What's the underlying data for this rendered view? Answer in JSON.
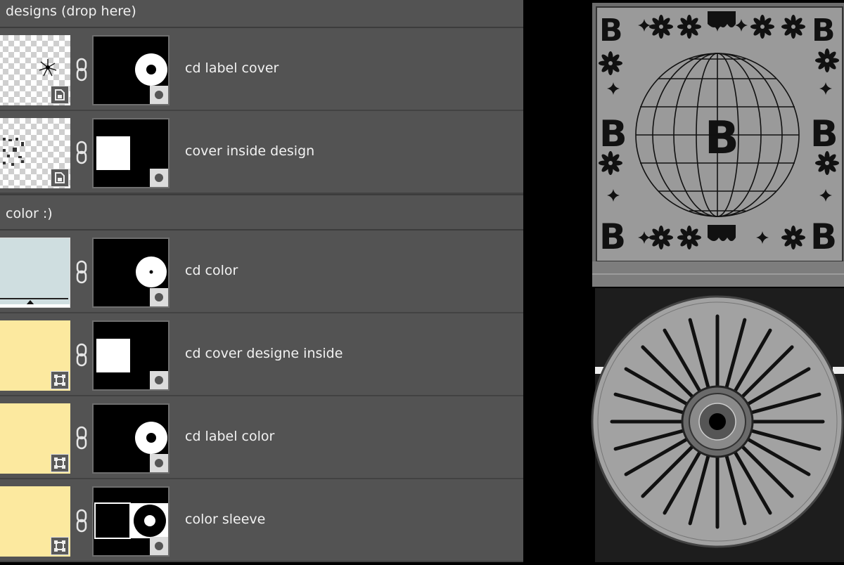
{
  "layers_panel": {
    "groups": [
      {
        "label": "designs (drop here)"
      },
      {
        "label": "color :)"
      }
    ],
    "layers": [
      {
        "name": "cd label cover",
        "thumb": "transparent-design",
        "badge_icon": "smart-object-icon",
        "mask": "ring-right"
      },
      {
        "name": "cover inside design",
        "thumb": "transparent-design",
        "badge_icon": "smart-object-icon",
        "mask": "square-left"
      },
      {
        "name": "cd color",
        "thumb": "bluegray-fill",
        "badge_icon": "none",
        "mask": "ring-small-hole"
      },
      {
        "name": "cd cover designe inside",
        "thumb": "yellow-fill",
        "badge_icon": "shape-icon",
        "mask": "square-left"
      },
      {
        "name": "cd label color",
        "thumb": "yellow-fill",
        "badge_icon": "shape-icon",
        "mask": "ring-right"
      },
      {
        "name": "color sleeve",
        "thumb": "yellow-fill",
        "badge_icon": "shape-icon",
        "mask": "sleeve"
      }
    ]
  },
  "preview": {
    "glyph": "B",
    "colors": {
      "panel_bg": "#535353",
      "swatch_yellow": "#fce99f",
      "swatch_bluegray": "#cfdee0",
      "preview_gray": "#9a9a9a"
    }
  }
}
